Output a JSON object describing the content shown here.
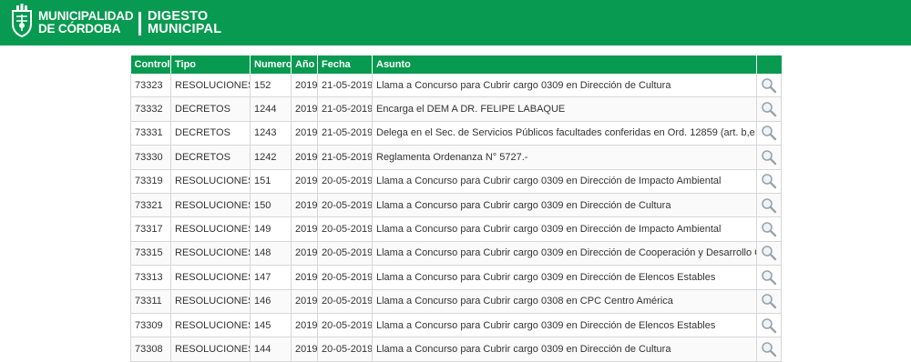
{
  "brand": {
    "line1": "MUNICIPALIDAD",
    "line2": "DE CÓRDOBA",
    "app_line1": "DIGESTO",
    "app_line2": "MUNICIPAL",
    "color": "#079a50"
  },
  "table": {
    "columns": [
      "Control",
      "Tipo",
      "Numero",
      "Año",
      "Fecha",
      "Asunto",
      ""
    ],
    "row_icon": "magnifier-icon",
    "rows": [
      {
        "control": "73323",
        "tipo": "RESOLUCIONES",
        "numero": "152",
        "anio": "2019",
        "fecha": "21-05-2019",
        "asunto": "Llama a Concurso para Cubrir cargo 0309 en Dirección de Cultura"
      },
      {
        "control": "73332",
        "tipo": "DECRETOS",
        "numero": "1244",
        "anio": "2019",
        "fecha": "21-05-2019",
        "asunto": "Encarga el DEM A DR. FELIPE LABAQUE"
      },
      {
        "control": "73331",
        "tipo": "DECRETOS",
        "numero": "1243",
        "anio": "2019",
        "fecha": "21-05-2019",
        "asunto": "Delega en el Sec. de Servicios Públicos facultades conferidas en Ord. 12859 (art. b,e y h)"
      },
      {
        "control": "73330",
        "tipo": "DECRETOS",
        "numero": "1242",
        "anio": "2019",
        "fecha": "21-05-2019",
        "asunto": "Reglamenta Ordenanza N° 5727.-"
      },
      {
        "control": "73319",
        "tipo": "RESOLUCIONES",
        "numero": "151",
        "anio": "2019",
        "fecha": "20-05-2019",
        "asunto": "Llama a Concurso para Cubrir cargo 0309 en Dirección de Impacto Ambiental"
      },
      {
        "control": "73321",
        "tipo": "RESOLUCIONES",
        "numero": "150",
        "anio": "2019",
        "fecha": "20-05-2019",
        "asunto": "Llama a Concurso para Cubrir cargo 0309 en Dirección de Cultura"
      },
      {
        "control": "73317",
        "tipo": "RESOLUCIONES",
        "numero": "149",
        "anio": "2019",
        "fecha": "20-05-2019",
        "asunto": "Llama a Concurso para Cubrir cargo 0309 en Dirección de Impacto Ambiental"
      },
      {
        "control": "73315",
        "tipo": "RESOLUCIONES",
        "numero": "148",
        "anio": "2019",
        "fecha": "20-05-2019",
        "asunto": "Llama a Concurso para Cubrir cargo 0309 en Dirección de Cooperación y Desarrollo Cultural"
      },
      {
        "control": "73313",
        "tipo": "RESOLUCIONES",
        "numero": "147",
        "anio": "2019",
        "fecha": "20-05-2019",
        "asunto": "Llama a Concurso para Cubrir cargo 0309 en Dirección de Elencos Estables"
      },
      {
        "control": "73311",
        "tipo": "RESOLUCIONES",
        "numero": "146",
        "anio": "2019",
        "fecha": "20-05-2019",
        "asunto": "Llama a Concurso para Cubrir cargo 0308 en CPC Centro América"
      },
      {
        "control": "73309",
        "tipo": "RESOLUCIONES",
        "numero": "145",
        "anio": "2019",
        "fecha": "20-05-2019",
        "asunto": "Llama a Concurso para Cubrir cargo 0309 en Dirección de Elencos Estables"
      },
      {
        "control": "73308",
        "tipo": "RESOLUCIONES",
        "numero": "144",
        "anio": "2019",
        "fecha": "20-05-2019",
        "asunto": "Llama a Concurso para Cubrir cargo 0309 en Dirección de Cultura"
      }
    ]
  }
}
